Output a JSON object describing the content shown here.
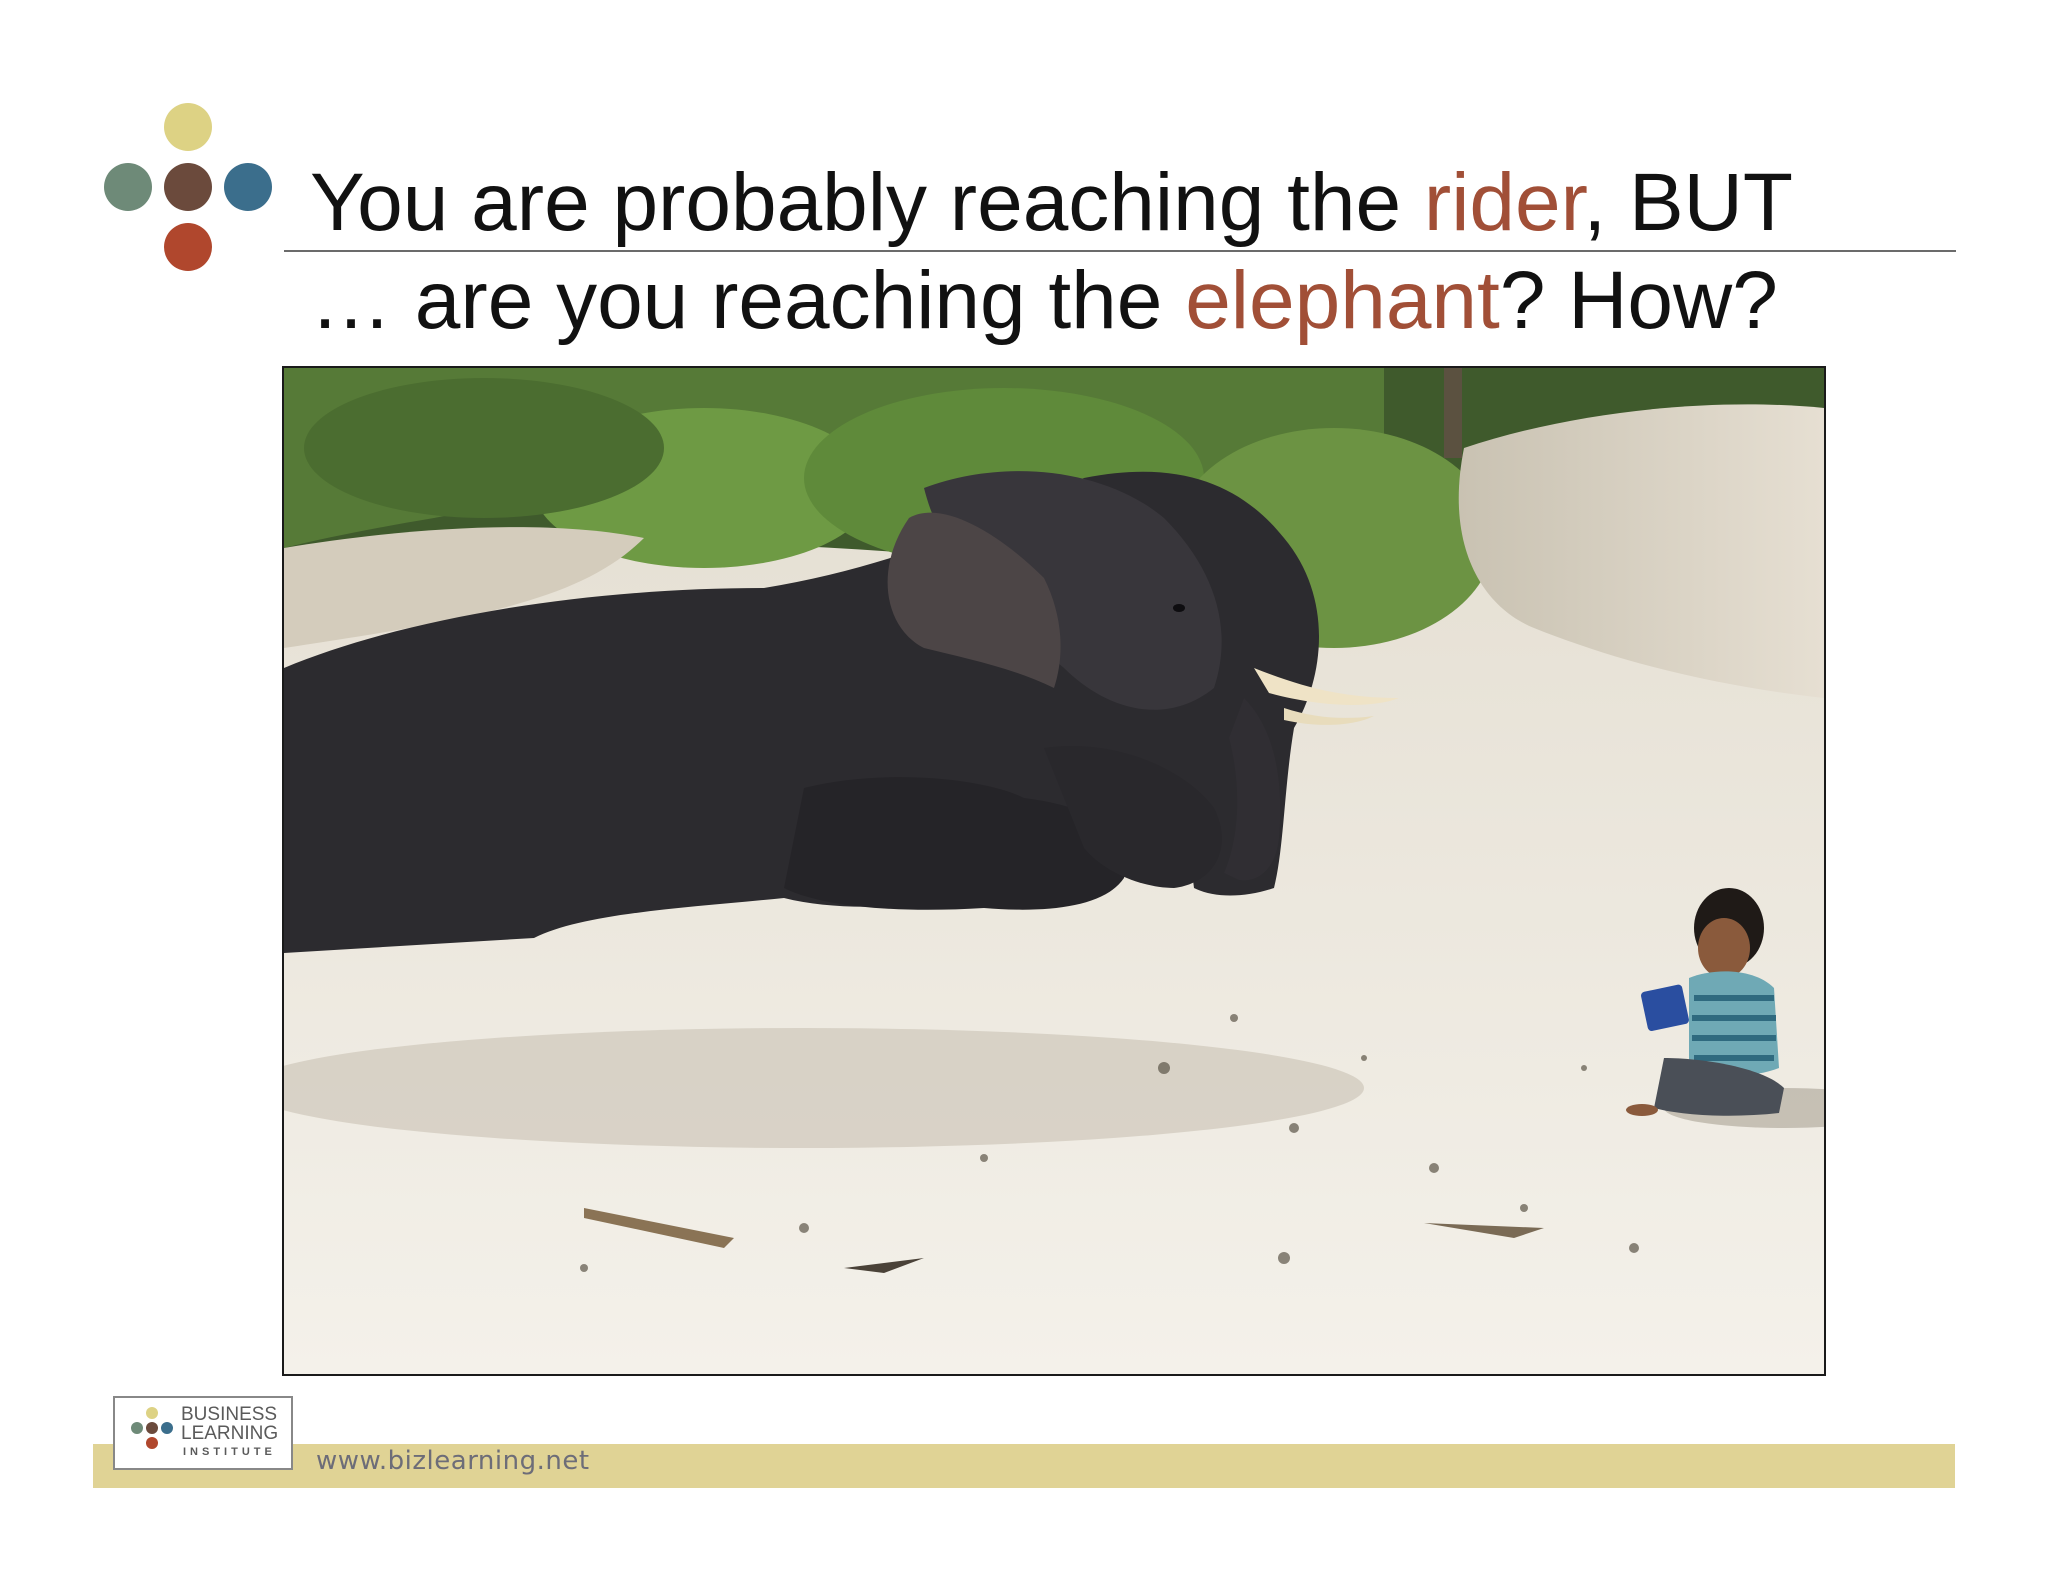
{
  "slide": {
    "title_line1_pre": "You are probably reaching the ",
    "title_line1_accent": "rider",
    "title_line1_post": ", BUT",
    "title_line2_pre": "… are you reaching the ",
    "title_line2_accent": "elephant",
    "title_line2_post": "? How?"
  },
  "footer": {
    "logo_line1": "BUSINESS",
    "logo_line2": "LEARNING",
    "logo_line3": "INSTITUTE",
    "url": "www.bizlearning.net"
  },
  "colors": {
    "accent": "#a14f37",
    "dot_yellow": "#ddd284",
    "dot_green": "#6e8a78",
    "dot_brown": "#6b4a3c",
    "dot_blue": "#3b6e8c",
    "dot_red": "#b0472d",
    "footer_band": "#e0d395"
  }
}
